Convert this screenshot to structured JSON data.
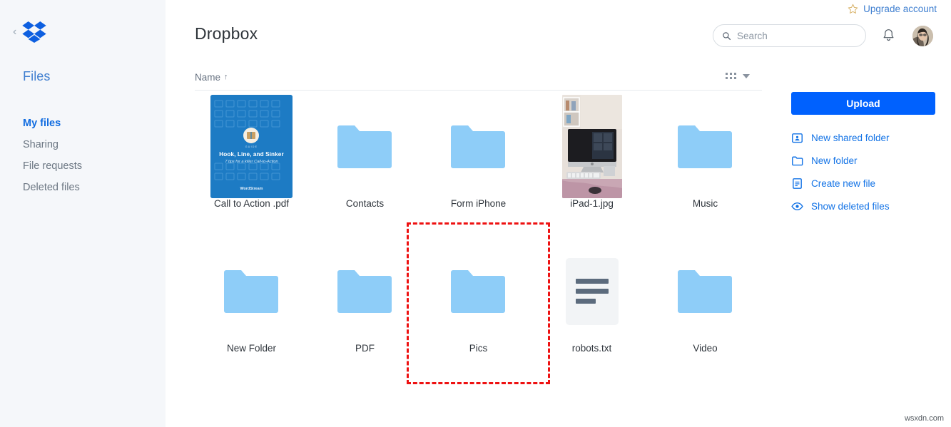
{
  "sidebar": {
    "logo_icon": "dropbox-logo",
    "collapse_icon": "chevron-left-icon",
    "collapse_glyph": "‹",
    "section_label": "Files",
    "items": [
      {
        "label": "My files",
        "active": true
      },
      {
        "label": "Sharing",
        "active": false
      },
      {
        "label": "File requests",
        "active": false
      },
      {
        "label": "Deleted files",
        "active": false
      }
    ]
  },
  "header": {
    "title": "Dropbox",
    "upgrade_label": "Upgrade account",
    "upgrade_icon": "star-icon",
    "search": {
      "placeholder": "Search",
      "value": "",
      "icon": "search-icon"
    },
    "bell_icon": "notification-bell-icon",
    "avatar_icon": "user-avatar"
  },
  "toolbar": {
    "name_column_label": "Name",
    "sort_arrow_glyph": "↑",
    "sort_direction": "ascending",
    "view_icon": "grid-view-icon",
    "caret_icon": "chevron-down-icon"
  },
  "files": [
    {
      "name": "Call to Action .pdf",
      "type": "pdf",
      "selected": false,
      "cover": {
        "badge": "GUIDE",
        "title": "Hook, Line, and Sinker",
        "subtitle": "7 tips for a killer Call-to-Action",
        "brand": "WordStream"
      }
    },
    {
      "name": "Contacts",
      "type": "folder",
      "selected": false
    },
    {
      "name": "Form iPhone",
      "type": "folder",
      "selected": false
    },
    {
      "name": "iPad-1.jpg",
      "type": "photo",
      "selected": false
    },
    {
      "name": "Music",
      "type": "folder",
      "selected": false
    },
    {
      "name": "New Folder",
      "type": "folder",
      "selected": false
    },
    {
      "name": "PDF",
      "type": "folder",
      "selected": false
    },
    {
      "name": "Pics",
      "type": "folder",
      "selected": true
    },
    {
      "name": "robots.txt",
      "type": "text",
      "selected": false
    },
    {
      "name": "Video",
      "type": "folder",
      "selected": false
    }
  ],
  "right_panel": {
    "upload_label": "Upload",
    "actions": [
      {
        "label": "New shared folder",
        "icon": "shared-folder-icon"
      },
      {
        "label": "New folder",
        "icon": "folder-icon"
      },
      {
        "label": "Create new file",
        "icon": "document-icon"
      },
      {
        "label": "Show deleted files",
        "icon": "eye-icon"
      }
    ]
  },
  "watermark": "wsxdn.com",
  "colors": {
    "brand_blue": "#0061fe",
    "link_blue": "#1373e6",
    "folder_blue": "#8ecdf8",
    "selection_red": "#ee1111",
    "sidebar_bg": "#f5f7fa"
  }
}
